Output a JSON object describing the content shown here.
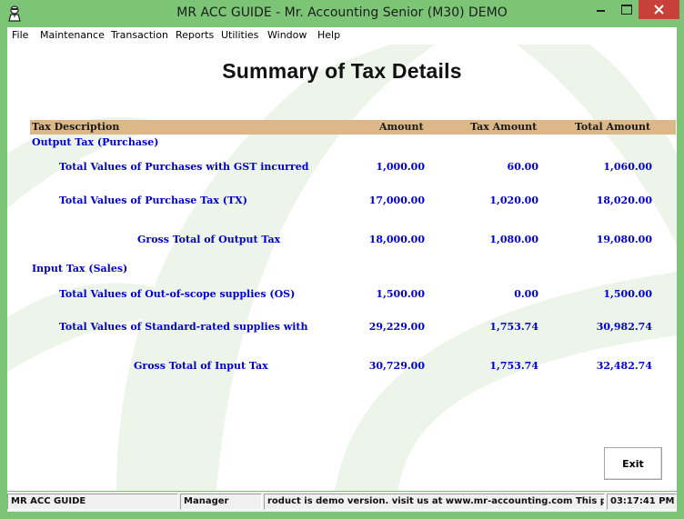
{
  "window": {
    "title": "MR ACC GUIDE - Mr. Accounting Senior (M30) DEMO"
  },
  "menu": [
    {
      "label": "File"
    },
    {
      "label": "Maintenance"
    },
    {
      "label": "Transaction"
    },
    {
      "label": "Reports"
    },
    {
      "label": "Utilities"
    },
    {
      "label": "Window"
    },
    {
      "label": "Help"
    }
  ],
  "report": {
    "title": "Summary of Tax Details",
    "headers": {
      "description": "Tax Description",
      "amount": "Amount",
      "tax_amount": "Tax Amount",
      "total_amount": "Total Amount"
    },
    "output_section": "Output Tax (Purchase)",
    "output_rows": [
      {
        "label": "Total Values of Purchases with GST incurred",
        "amount": "1,000.00",
        "tax": "60.00",
        "total": "1,060.00"
      },
      {
        "label": "Total Values of Purchase Tax  (TX)",
        "amount": "17,000.00",
        "tax": "1,020.00",
        "total": "18,020.00"
      }
    ],
    "output_gross": {
      "label": "Gross Total of Output Tax",
      "amount": "18,000.00",
      "tax": "1,080.00",
      "total": "19,080.00"
    },
    "input_section": "Input Tax (Sales)",
    "input_rows": [
      {
        "label": "Total Values of Out-of-scope supplies  (OS)",
        "amount": "1,500.00",
        "tax": "0.00",
        "total": "1,500.00"
      },
      {
        "label": "Total Values of Standard-rated supplies with",
        "amount": "29,229.00",
        "tax": "1,753.74",
        "total": "30,982.74"
      }
    ],
    "input_gross": {
      "label": "Gross Total of Input Tax",
      "amount": "30,729.00",
      "tax": "1,753.74",
      "total": "32,482.74"
    }
  },
  "buttons": {
    "exit": "Exit"
  },
  "status": {
    "company": "MR ACC GUIDE",
    "user": "Manager",
    "message": "roduct is demo version.  visit us at www.mr-accounting.com This p",
    "time": "03:17:41 PM"
  },
  "colors": {
    "frame": "#7cc576",
    "header_band": "#dcb787",
    "row_text": "#0000cc",
    "close_button": "#c74039"
  }
}
